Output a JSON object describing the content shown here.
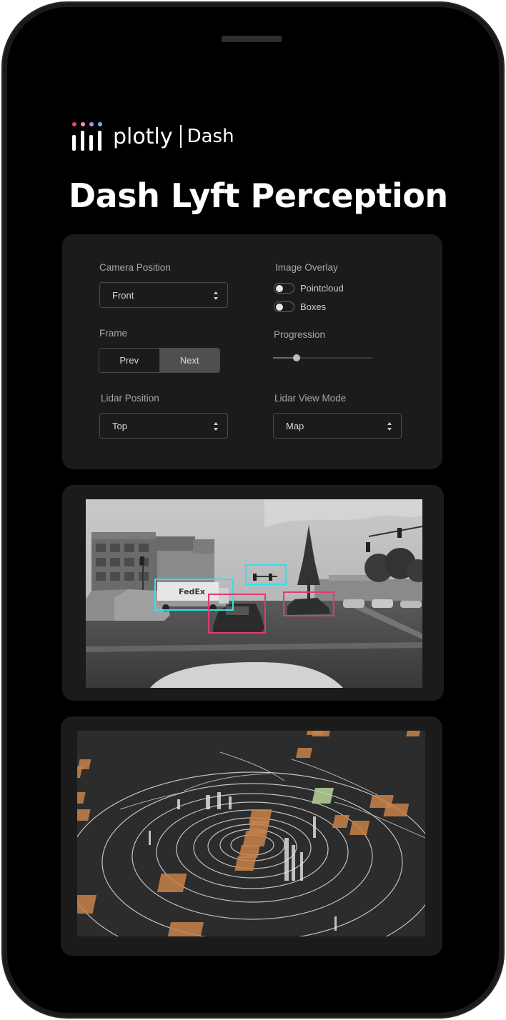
{
  "app": {
    "brand": "plotly",
    "product": "Dash",
    "title": "Dash Lyft Perception"
  },
  "controls": {
    "camera_position": {
      "label": "Camera Position",
      "value": "Front"
    },
    "image_overlay": {
      "label": "Image Overlay",
      "options": [
        {
          "label": "Pointcloud",
          "enabled": false
        },
        {
          "label": "Boxes",
          "enabled": false
        }
      ]
    },
    "frame": {
      "label": "Frame",
      "prev_label": "Prev",
      "next_label": "Next"
    },
    "progression": {
      "label": "Progression",
      "value": 0.22
    },
    "lidar_position": {
      "label": "Lidar Position",
      "value": "Top"
    },
    "lidar_view_mode": {
      "label": "Lidar View Mode",
      "value": "Map"
    }
  },
  "camera_view": {
    "truck_logo_text": "FedEx",
    "box_colors": {
      "truck_and_light": "#2de3ea",
      "car": "#e23a6d"
    }
  },
  "colors": {
    "background": "#000000",
    "card": "#1b1b1b",
    "lidar_background": "#2c2c2c",
    "lidar_box": "#c8824a",
    "lidar_box_alt": "#b9d39a"
  }
}
